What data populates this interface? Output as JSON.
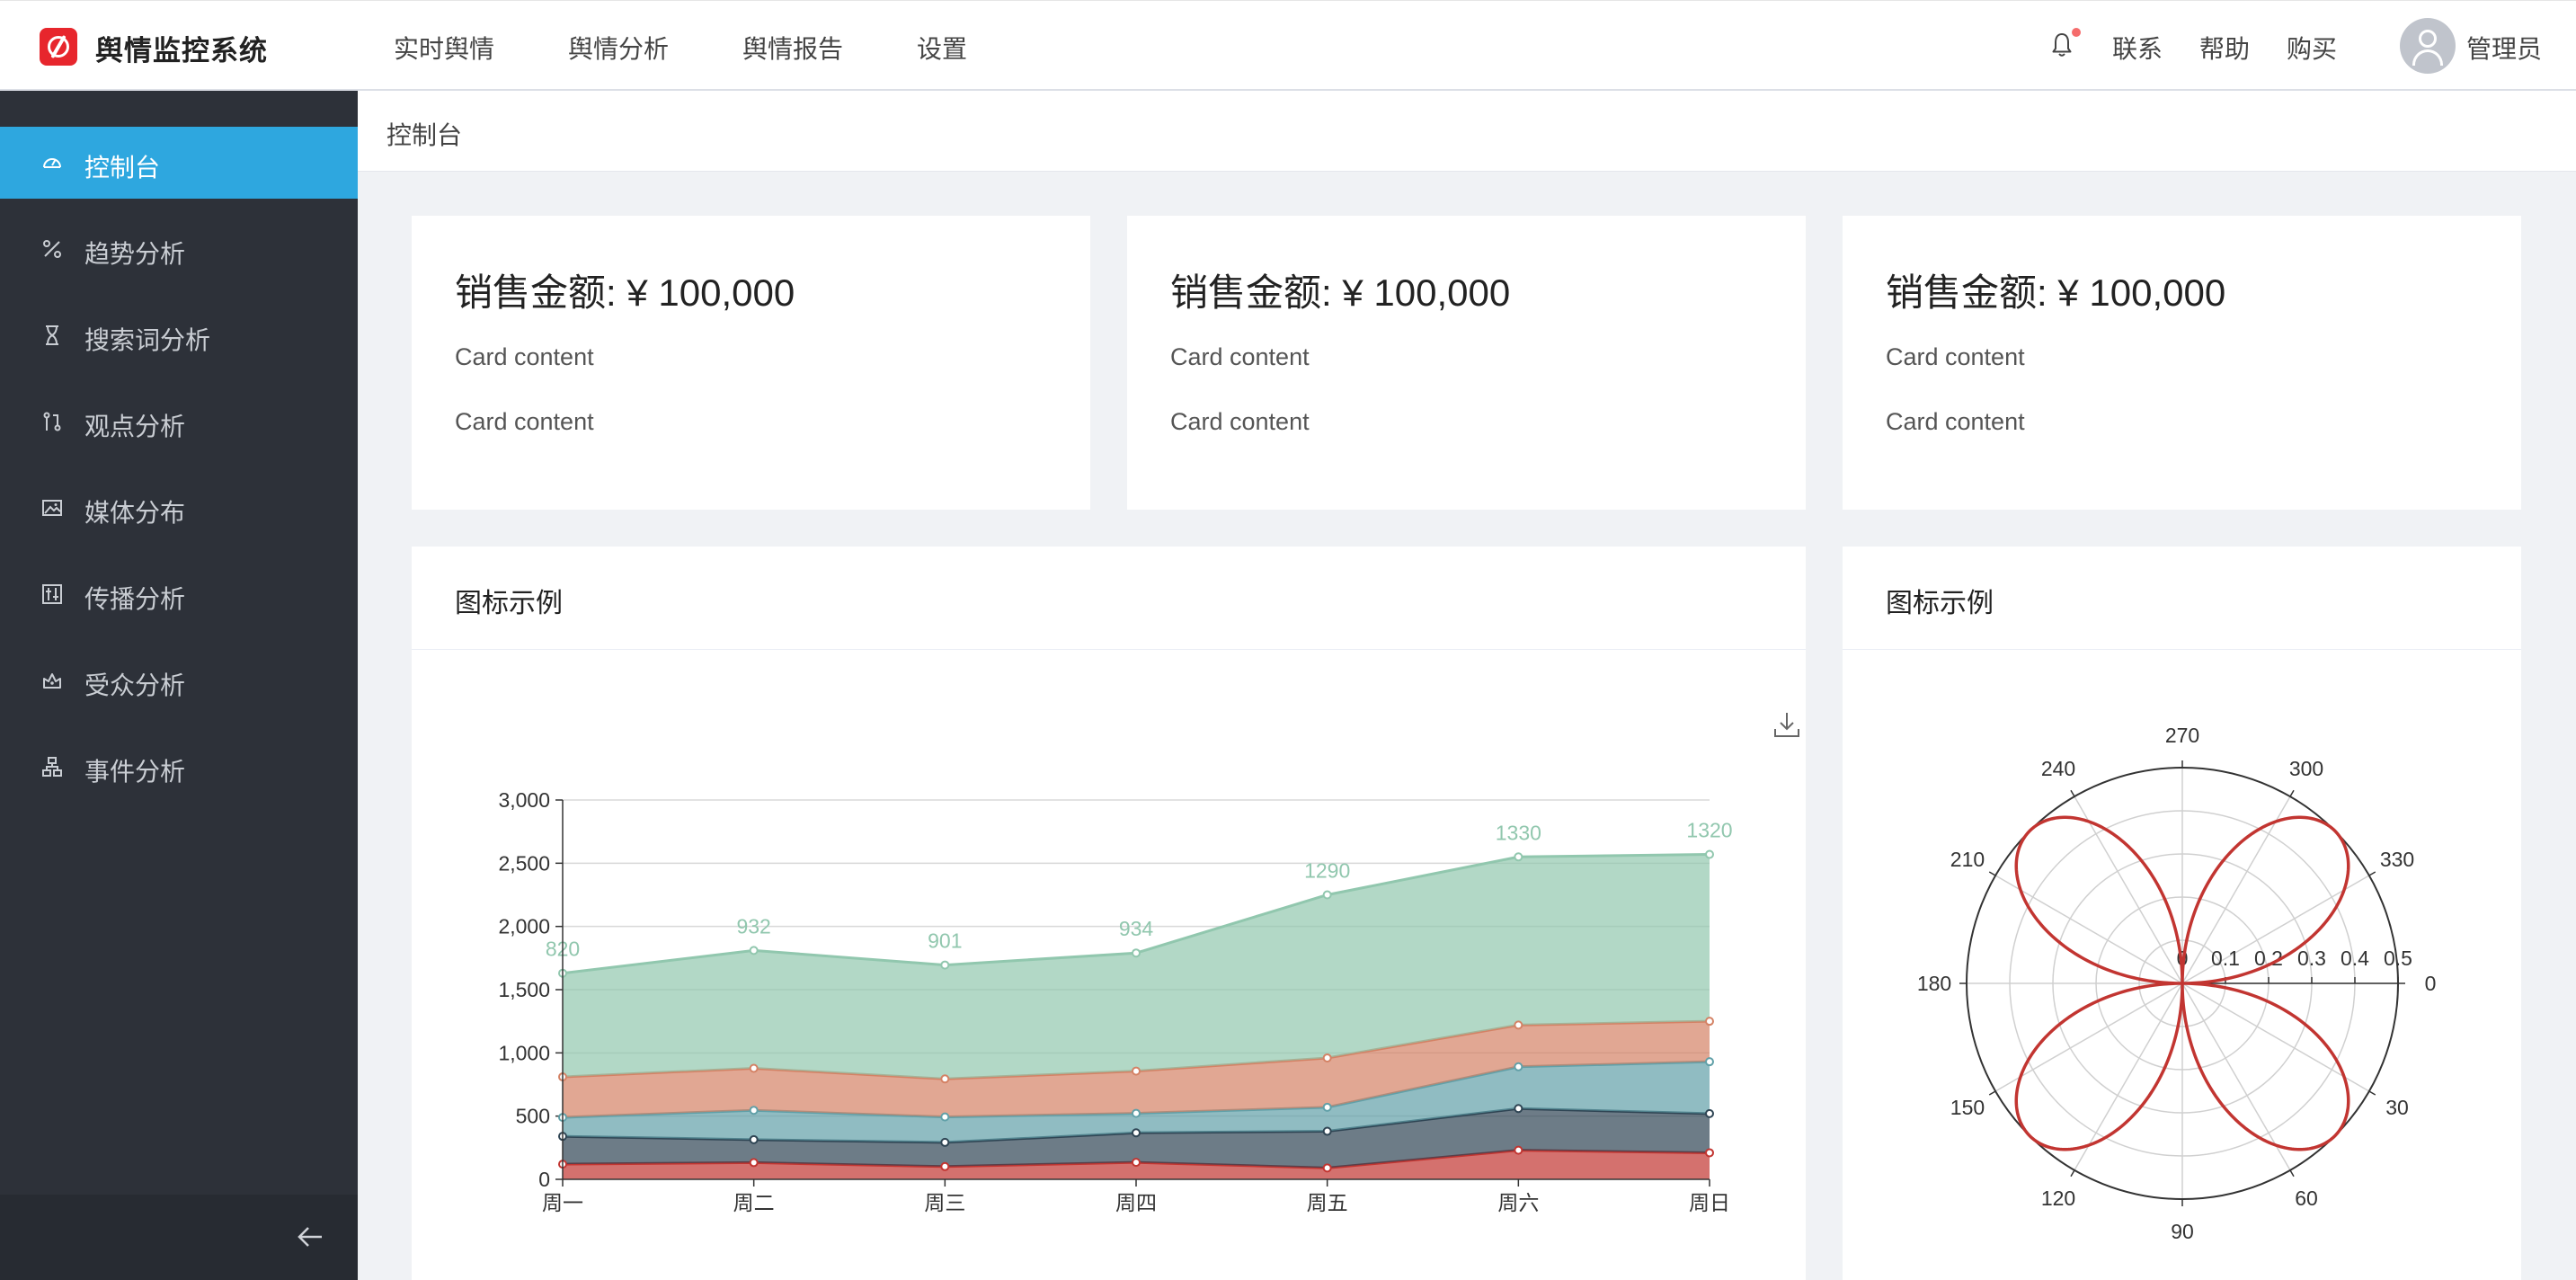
{
  "header": {
    "app_title": "舆情监控系统",
    "nav": [
      "实时舆情",
      "舆情分析",
      "舆情报告",
      "设置"
    ],
    "links": [
      "联系",
      "帮助",
      "购买"
    ],
    "user": "管理员",
    "colors": {
      "brand": "#e7262d",
      "notification_dot": "#f56c6c"
    }
  },
  "sidebar": {
    "items": [
      {
        "label": "控制台",
        "icon": "dashboard-icon",
        "active": true
      },
      {
        "label": "趋势分析",
        "icon": "percent-icon"
      },
      {
        "label": "搜索词分析",
        "icon": "hourglass-icon"
      },
      {
        "label": "观点分析",
        "icon": "branch-icon"
      },
      {
        "label": "媒体分布",
        "icon": "picture-icon"
      },
      {
        "label": "传播分析",
        "icon": "sliders-icon"
      },
      {
        "label": "受众分析",
        "icon": "crown-icon"
      },
      {
        "label": "事件分析",
        "icon": "network-icon"
      }
    ],
    "collapse_icon": "arrow-left-icon",
    "colors": {
      "background": "#2d3139",
      "active": "#2ea7df"
    }
  },
  "breadcrumb": "控制台",
  "cards": [
    {
      "title": "销售金额: ¥ 100,000",
      "lines": [
        "Card content",
        "Card content"
      ]
    },
    {
      "title": "销售金额: ¥ 100,000",
      "lines": [
        "Card content",
        "Card content"
      ]
    },
    {
      "title": "销售金额: ¥ 100,000",
      "lines": [
        "Card content",
        "Card content"
      ]
    }
  ],
  "panels": {
    "area_title": "图标示例",
    "polar_title": "图标示例",
    "download_icon": "download-icon"
  },
  "chart_data": [
    {
      "type": "area",
      "stacked": true,
      "categories": [
        "周一",
        "周二",
        "周三",
        "周四",
        "周五",
        "周六",
        "周日"
      ],
      "ylim": [
        0,
        3000
      ],
      "yticks": [
        "0",
        "500",
        "1,000",
        "1,500",
        "2,000",
        "2,500",
        "3,000"
      ],
      "grid": true,
      "series": [
        {
          "color": "#c23531",
          "values": [
            120,
            132,
            101,
            134,
            90,
            230,
            210
          ]
        },
        {
          "color": "#2f4554",
          "values": [
            220,
            182,
            191,
            234,
            290,
            330,
            310
          ]
        },
        {
          "color": "#61a0a8",
          "values": [
            150,
            232,
            201,
            154,
            190,
            330,
            410
          ]
        },
        {
          "color": "#d48265",
          "values": [
            320,
            332,
            301,
            334,
            390,
            330,
            320
          ]
        },
        {
          "color": "#91c7ae",
          "values": [
            820,
            932,
            901,
            934,
            1290,
            1330,
            1320
          ],
          "labels": [
            "820",
            "932",
            "901",
            "934",
            "1290",
            "1330",
            "1320"
          ]
        }
      ]
    },
    {
      "type": "polar-line",
      "angle_ticks": [
        "0",
        "30",
        "60",
        "90",
        "120",
        "150",
        "180",
        "210",
        "240",
        "270",
        "300",
        "330"
      ],
      "radius_ticks": [
        "0",
        "0.1",
        "0.2",
        "0.3",
        "0.4",
        "0.5"
      ],
      "rlim": [
        0,
        0.5
      ],
      "curve": "r = 0.5 * |sin(2θ)|",
      "color": "#c23531"
    }
  ]
}
